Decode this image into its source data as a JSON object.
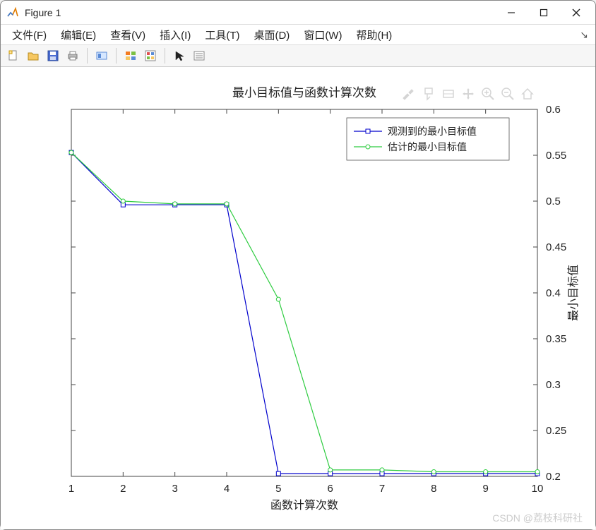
{
  "window": {
    "title": "Figure 1"
  },
  "menubar": {
    "items": [
      "文件(F)",
      "编辑(E)",
      "查看(V)",
      "插入(I)",
      "工具(T)",
      "桌面(D)",
      "窗口(W)",
      "帮助(H)"
    ]
  },
  "toolbar": {
    "icons": [
      "new-file-icon",
      "open-folder-icon",
      "save-icon",
      "print-icon",
      "sep",
      "data-cursor-icon",
      "sep",
      "color-legend-icon",
      "color-order-icon",
      "sep",
      "arrow-cursor-icon",
      "properties-icon"
    ]
  },
  "axes_toolbar": {
    "icons": [
      "brush-icon",
      "datatip-icon",
      "rotate-icon",
      "pan-icon",
      "zoom-in-icon",
      "zoom-out-icon",
      "home-icon"
    ]
  },
  "chart_data": {
    "type": "line",
    "title": "最小目标值与函数计算次数",
    "xlabel": "函数计算次数",
    "ylabel": "最小目标值",
    "xlim": [
      1,
      10
    ],
    "ylim": [
      0.2,
      0.6
    ],
    "xticks": [
      1,
      2,
      3,
      4,
      5,
      6,
      7,
      8,
      9,
      10
    ],
    "yticks": [
      0.2,
      0.25,
      0.3,
      0.35,
      0.4,
      0.45,
      0.5,
      0.55,
      0.6
    ],
    "y_axis_side": "right",
    "legend_position": "top-right-inside",
    "series": [
      {
        "name": "观测到的最小目标值",
        "color": "#0000cc",
        "marker": "square",
        "x": [
          1,
          2,
          3,
          4,
          5,
          6,
          7,
          8,
          9,
          10
        ],
        "y": [
          0.553,
          0.496,
          0.496,
          0.496,
          0.203,
          0.203,
          0.203,
          0.203,
          0.203,
          0.203
        ]
      },
      {
        "name": "估计的最小目标值",
        "color": "#2ecc40",
        "marker": "circle",
        "x": [
          1,
          2,
          3,
          4,
          5,
          6,
          7,
          8,
          9,
          10
        ],
        "y": [
          0.553,
          0.5,
          0.497,
          0.497,
          0.393,
          0.207,
          0.207,
          0.205,
          0.205,
          0.205
        ]
      }
    ]
  },
  "watermark": "CSDN @荔枝科研社"
}
